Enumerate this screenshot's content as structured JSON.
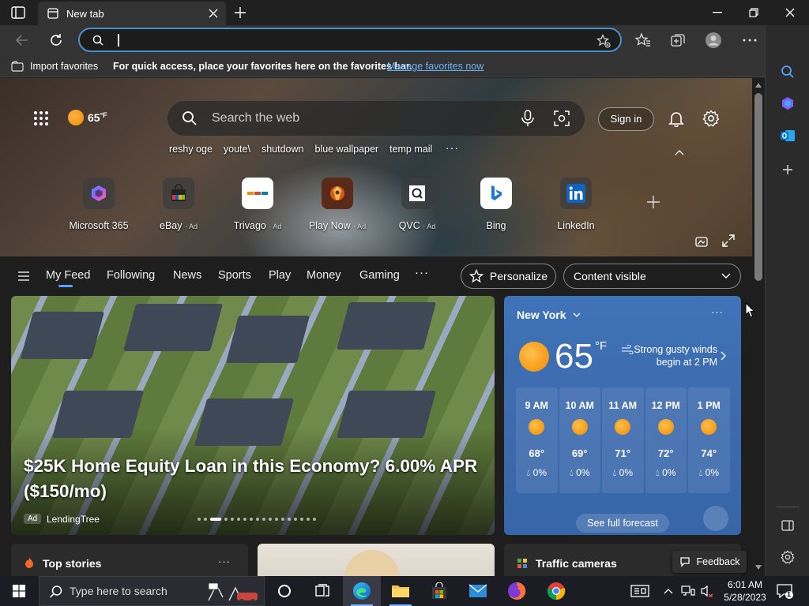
{
  "browser": {
    "tab_title": "New tab",
    "address_value": ""
  },
  "favorites_bar": {
    "import_label": "Import favorites",
    "hint_text": "For quick access, place your favorites here on the favorites bar.",
    "manage_link": "Manage favorites now"
  },
  "header": {
    "temperature": "65",
    "temp_unit": "°F",
    "search_placeholder": "Search the web",
    "sign_in": "Sign in"
  },
  "recent_searches": [
    "reshy oge",
    "youte\\",
    "shutdown",
    "blue wallpaper",
    "temp mail"
  ],
  "quick_links": [
    {
      "label": "Microsoft 365",
      "ad": ""
    },
    {
      "label": "eBay",
      "ad": "· Ad"
    },
    {
      "label": "Trivago",
      "ad": "· Ad"
    },
    {
      "label": "Play Now",
      "ad": "· Ad"
    },
    {
      "label": "QVC",
      "ad": "· Ad"
    },
    {
      "label": "Bing",
      "ad": ""
    },
    {
      "label": "LinkedIn",
      "ad": ""
    }
  ],
  "feed_nav": {
    "tabs": [
      "My Feed",
      "Following",
      "News",
      "Sports",
      "Play",
      "Money",
      "Gaming"
    ],
    "more": "···",
    "personalize": "Personalize",
    "content_visible": "Content visible"
  },
  "main_card": {
    "headline": "$25K Home Equity Loan in this Economy? 6.00% APR ($150/mo)",
    "ad_badge": "Ad",
    "source": "LendingTree"
  },
  "weather": {
    "city": "New York",
    "temp": "65",
    "unit": "°F",
    "alert": "Strong gusty winds begin at 2 PM",
    "hourly": [
      {
        "time": "9 AM",
        "temp": "68°",
        "rain": "0%"
      },
      {
        "time": "10 AM",
        "temp": "69°",
        "rain": "0%"
      },
      {
        "time": "11 AM",
        "temp": "71°",
        "rain": "0%"
      },
      {
        "time": "12 PM",
        "temp": "72°",
        "rain": "0%"
      },
      {
        "time": "1 PM",
        "temp": "74°",
        "rain": "0%"
      }
    ],
    "forecast_button": "See full forecast"
  },
  "bottom": {
    "top_stories": "Top stories",
    "traffic": "Traffic cameras",
    "feedback": "Feedback",
    "more": "···"
  },
  "taskbar": {
    "search_placeholder": "Type here to search",
    "time": "6:01 AM",
    "date": "5/28/2023",
    "notification_count": "1"
  },
  "colors": {
    "accent": "#4a90c8",
    "link": "#6ab1f5",
    "weather_bg": "#3d6bae",
    "page_bg": "#1e1e1e"
  }
}
